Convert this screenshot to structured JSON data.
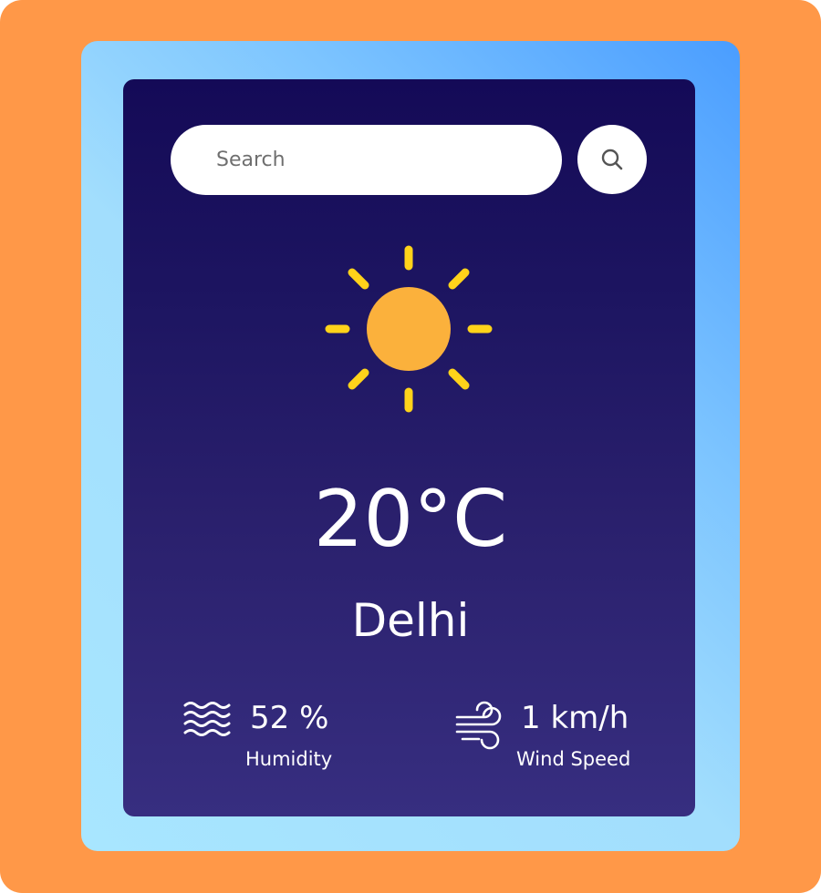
{
  "search": {
    "placeholder": "Search",
    "button_icon": "search-icon"
  },
  "weather": {
    "condition_icon": "sun-icon",
    "temperature": "20°C",
    "city": "Delhi"
  },
  "details": {
    "humidity": {
      "icon": "humidity-icon",
      "value": "52 %",
      "label": "Humidity"
    },
    "wind": {
      "icon": "wind-icon",
      "value": "1 km/h",
      "label": "Wind Speed"
    }
  },
  "colors": {
    "page_background": "#ff9848",
    "card_gradient_top": "#140a57",
    "card_gradient_bottom": "#372e80",
    "outer_gradient_start": "#4a9dff",
    "outer_gradient_end": "#a8e6ff",
    "sun_body": "#fbb13c",
    "sun_rays": "#ffd31a"
  }
}
